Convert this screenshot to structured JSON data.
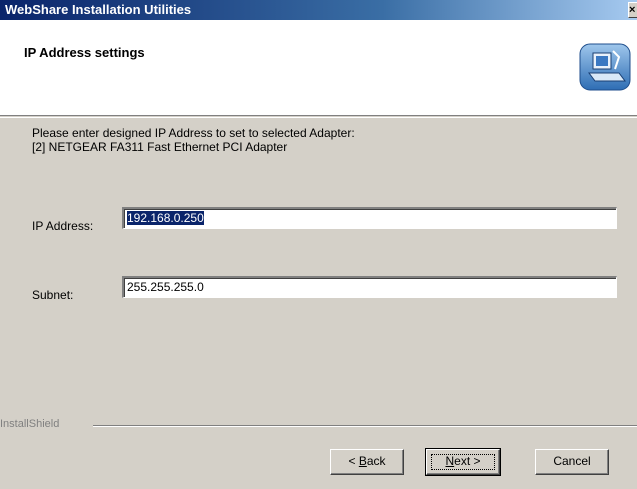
{
  "window": {
    "title": "WebShare Installation Utilities",
    "close_glyph": "×"
  },
  "header": {
    "title": "IP Address settings",
    "icon": "computer-setup-icon"
  },
  "instructions": {
    "line1": "Please enter designed IP Address to set to selected Adapter:",
    "line2": "[2] NETGEAR FA311 Fast Ethernet PCI Adapter"
  },
  "form": {
    "ip_label": "IP Address:",
    "ip_value": "192.168.0.250",
    "subnet_label": "Subnet:",
    "subnet_value": "255.255.255.0"
  },
  "footer": {
    "brand": "InstallShield",
    "back_prefix": "< ",
    "back_accel": "B",
    "back_rest": "ack",
    "next_accel": "N",
    "next_rest": "ext >",
    "cancel_label": "Cancel"
  }
}
